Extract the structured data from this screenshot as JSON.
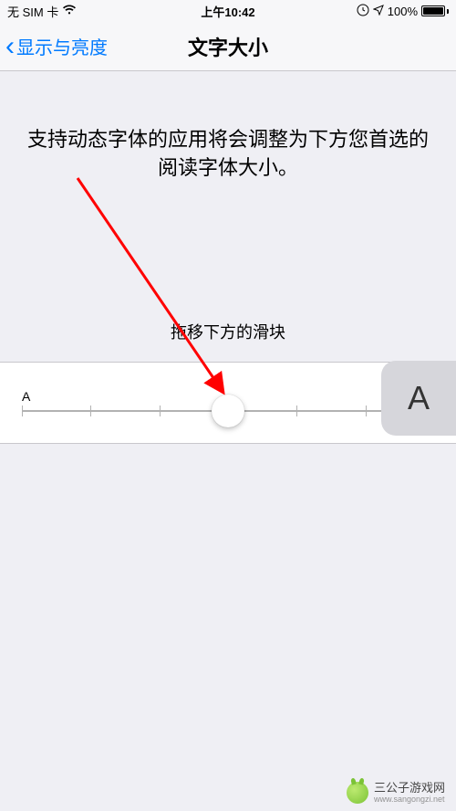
{
  "status": {
    "carrier": "无 SIM 卡",
    "time": "上午10:42",
    "battery_pct": "100%"
  },
  "nav": {
    "back_label": "显示与亮度",
    "title": "文字大小"
  },
  "main": {
    "description": "支持动态字体的应用将会调整为下方您首选的阅读字体大小。",
    "instruction": "拖移下方的滑块"
  },
  "slider": {
    "label_small": "A",
    "label_large": "A",
    "steps": 7,
    "value_index": 3
  },
  "overlay": {
    "bubble_text": "A"
  },
  "watermark": {
    "brand": "三公子游戏网",
    "url": "www.sangongzi.net"
  }
}
